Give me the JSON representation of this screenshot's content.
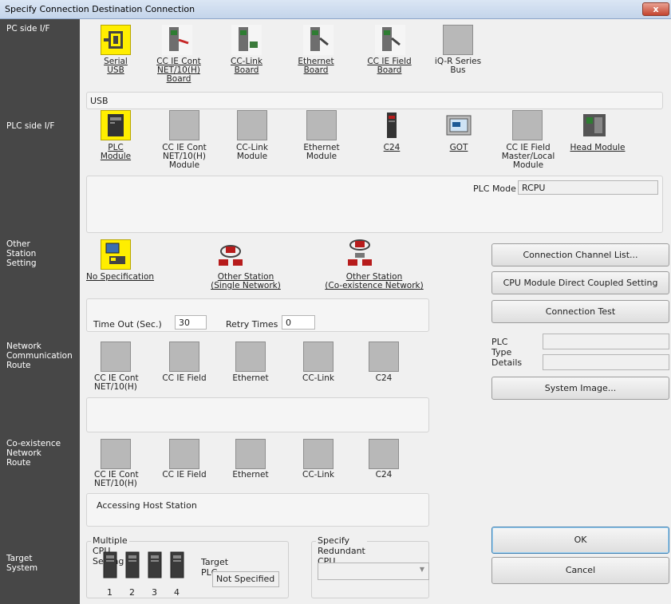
{
  "window": {
    "title": "Specify Connection Destination Connection",
    "close_label": "x"
  },
  "sections": {
    "pc_side": "PC side I/F",
    "plc_side": "PLC side I/F",
    "other_station": "Other\nStation\nSetting",
    "network_route": "Network\nCommunication\nRoute",
    "coexistence_route": "Co-existence\nNetwork\nRoute",
    "target_system": "Target\nSystem"
  },
  "pc_side": {
    "items": [
      {
        "label": "Serial\nUSB",
        "icon": "serial-usb-icon"
      },
      {
        "label": "CC IE Cont\nNET/10(H)\nBoard",
        "icon": "board-icon"
      },
      {
        "label": "CC-Link\nBoard",
        "icon": "board-icon"
      },
      {
        "label": "Ethernet\nBoard",
        "icon": "board-icon"
      },
      {
        "label": "CC IE Field\nBoard",
        "icon": "board-icon"
      },
      {
        "label": "iQ-R Series\nBus",
        "icon": "blank-tile"
      }
    ],
    "detail": "USB"
  },
  "plc_side": {
    "items": [
      {
        "label": "PLC\nModule"
      },
      {
        "label": "CC IE Cont\nNET/10(H)\nModule"
      },
      {
        "label": "CC-Link\nModule"
      },
      {
        "label": "Ethernet\nModule"
      },
      {
        "label": "C24"
      },
      {
        "label": "GOT"
      },
      {
        "label": "CC IE Field\nMaster/Local\nModule"
      },
      {
        "label": "Head Module"
      }
    ],
    "plc_mode_label": "PLC Mode",
    "plc_mode_value": "RCPU"
  },
  "other_station": {
    "items": [
      {
        "label": "No Specification"
      },
      {
        "label": "Other Station\n(Single Network)"
      },
      {
        "label": "Other Station\n(Co-existence Network)"
      }
    ],
    "timeout_label": "Time Out (Sec.)",
    "timeout_value": "30",
    "retry_label": "Retry Times",
    "retry_value": "0"
  },
  "network_route": {
    "items": [
      {
        "label": "CC IE Cont\nNET/10(H)"
      },
      {
        "label": "CC IE Field"
      },
      {
        "label": "Ethernet"
      },
      {
        "label": "CC-Link"
      },
      {
        "label": "C24"
      }
    ]
  },
  "coexistence_route": {
    "items": [
      {
        "label": "CC IE Cont\nNET/10(H)"
      },
      {
        "label": "CC IE Field"
      },
      {
        "label": "Ethernet"
      },
      {
        "label": "CC-Link"
      },
      {
        "label": "C24"
      }
    ],
    "detail": "Accessing Host Station"
  },
  "target_system": {
    "multiple_cpu_label": "Multiple CPU Setting",
    "cpu_numbers": [
      "1",
      "2",
      "3",
      "4"
    ],
    "target_plc_label": "Target PLC",
    "target_plc_value": "Not Specified",
    "redundant_label": "Specify Redundant CPU",
    "redundant_value": ""
  },
  "right_panel": {
    "connection_channel_list": "Connection Channel List...",
    "cpu_direct": "CPU Module Direct Coupled Setting",
    "connection_test": "Connection Test",
    "plc_type_label": "PLC Type",
    "plc_type_value": "",
    "details_label": "Details",
    "details_value": "",
    "system_image": "System Image...",
    "ok": "OK",
    "cancel": "Cancel"
  }
}
